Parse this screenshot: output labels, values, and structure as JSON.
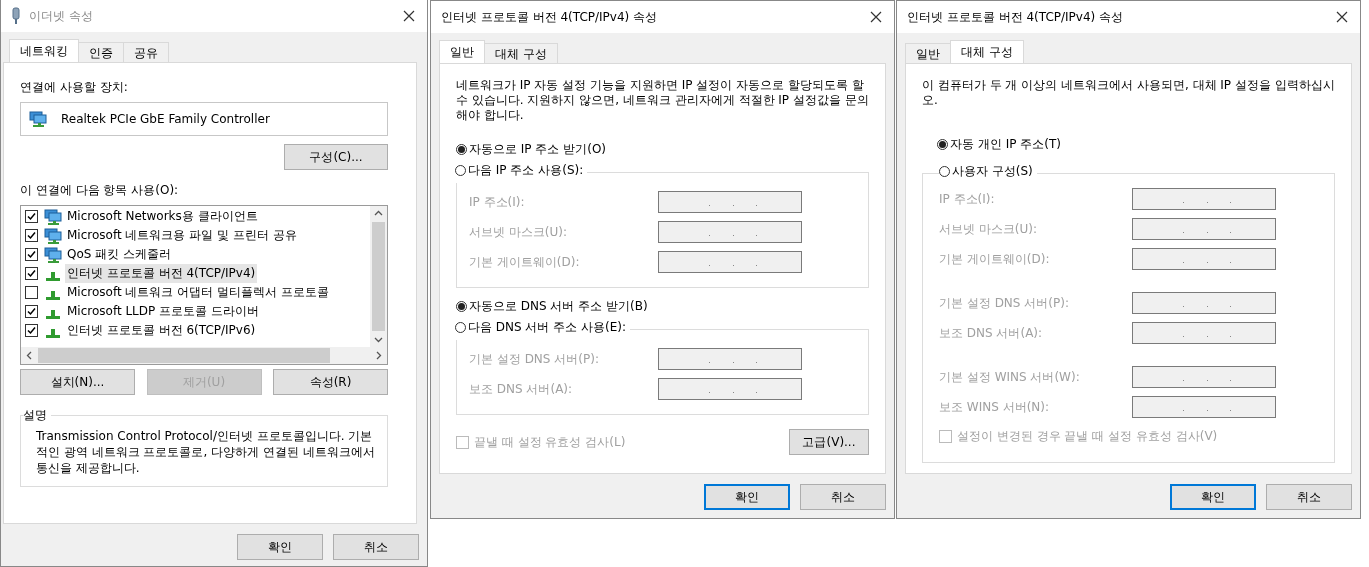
{
  "ethernet_dialog": {
    "title": "이더넷 속성",
    "tabs": [
      {
        "label": "네트워킹",
        "selected": true
      },
      {
        "label": "인증",
        "selected": false
      },
      {
        "label": "공유",
        "selected": false
      }
    ],
    "device_label": "연결에 사용할 장치:",
    "device": "Realtek PCIe GbE Family Controller",
    "configure_button": "구성(C)...",
    "items_label": "이 연결에 다음 항목 사용(O):",
    "items": [
      {
        "kind": "client",
        "label": "Microsoft Networks용 클라이언트",
        "checked": true,
        "selected": false
      },
      {
        "kind": "service",
        "label": "Microsoft 네트워크용 파일 및 프린터 공유",
        "checked": true,
        "selected": false
      },
      {
        "kind": "service",
        "label": "QoS 패킷 스케줄러",
        "checked": true,
        "selected": false
      },
      {
        "kind": "protocol",
        "label": "인터넷 프로토콜 버전 4(TCP/IPv4)",
        "checked": true,
        "selected": true
      },
      {
        "kind": "protocol",
        "label": "Microsoft 네트워크 어댑터 멀티플렉서 프로토콜",
        "checked": false,
        "selected": false
      },
      {
        "kind": "protocol",
        "label": "Microsoft LLDP 프로토콜 드라이버",
        "checked": true,
        "selected": false
      },
      {
        "kind": "protocol",
        "label": "인터넷 프로토콜 버전 6(TCP/IPv6)",
        "checked": true,
        "selected": false
      }
    ],
    "item_buttons": [
      {
        "label": "설치(N)...",
        "disabled": false
      },
      {
        "label": "제거(U)",
        "disabled": true
      },
      {
        "label": "속성(R)",
        "disabled": false
      }
    ],
    "description_title": "설명",
    "description": "Transmission Control Protocol/인터넷 프로토콜입니다. 기본적인 광역 네트워크 프로토콜로, 다양하게 연결된 네트워크에서 통신을 제공합니다.",
    "footer_buttons": [
      {
        "label": "확인",
        "default": false
      },
      {
        "label": "취소",
        "default": false
      }
    ]
  },
  "ipv4_general_dialog": {
    "title": "인터넷 프로토콜 버전 4(TCP/IPv4) 속성",
    "tabs": [
      {
        "label": "일반",
        "selected": true
      },
      {
        "label": "대체 구성",
        "selected": false
      }
    ],
    "intro": "네트워크가 IP 자동 설정 기능을 지원하면 IP 설정이 자동으로 할당되도록 할 수 있습니다. 지원하지 않으면, 네트워크 관리자에게 적절한 IP 설정값을 문의해야 합니다.",
    "sections": [
      {
        "auto_option": {
          "label": "자동으로 IP 주소 받기(O)",
          "selected": true
        },
        "manual_option": {
          "label": "다음 IP 주소 사용(S):",
          "selected": false
        },
        "fields": [
          {
            "label": "IP 주소(I):",
            "disabled": true
          },
          {
            "label": "서브넷 마스크(U):",
            "disabled": true
          },
          {
            "label": "기본 게이트웨이(D):",
            "disabled": true
          }
        ]
      },
      {
        "auto_option": {
          "label": "자동으로 DNS 서버 주소 받기(B)",
          "selected": true
        },
        "manual_option": {
          "label": "다음 DNS 서버 주소 사용(E):",
          "selected": false
        },
        "fields": [
          {
            "label": "기본 설정 DNS 서버(P):",
            "disabled": true
          },
          {
            "label": "보조 DNS 서버(A):",
            "disabled": true
          }
        ]
      }
    ],
    "validate": {
      "label": "끝낼 때 설정 유효성 검사(L)",
      "checked": false,
      "disabled": true
    },
    "advanced_button": "고급(V)...",
    "footer_buttons": [
      {
        "label": "확인",
        "default": true
      },
      {
        "label": "취소",
        "default": false
      }
    ]
  },
  "ipv4_alternate_dialog": {
    "title": "인터넷 프로토콜 버전 4(TCP/IPv4) 속성",
    "tabs": [
      {
        "label": "일반",
        "selected": false
      },
      {
        "label": "대체 구성",
        "selected": true
      }
    ],
    "intro": "이 컴퓨터가 두 개 이상의 네트워크에서 사용되면, 대체 IP 설정을 입력하십시오.",
    "auto_option": {
      "label": "자동 개인 IP 주소(T)",
      "selected": true
    },
    "manual_option": {
      "label": "사용자 구성(S)",
      "selected": false
    },
    "field_groups": [
      [
        {
          "label": "IP 주소(I):",
          "disabled": true
        },
        {
          "label": "서브넷 마스크(U):",
          "disabled": true
        },
        {
          "label": "기본 게이트웨이(D):",
          "disabled": true
        }
      ],
      [
        {
          "label": "기본 설정 DNS 서버(P):",
          "disabled": true
        },
        {
          "label": "보조 DNS 서버(A):",
          "disabled": true
        }
      ],
      [
        {
          "label": "기본 설정 WINS 서버(W):",
          "disabled": true
        },
        {
          "label": "보조 WINS 서버(N):",
          "disabled": true
        }
      ]
    ],
    "validate": {
      "label": "설정이 변경된 경우 끝낼 때 설정 유효성 검사(V)",
      "checked": false,
      "disabled": true
    },
    "footer_buttons": [
      {
        "label": "확인",
        "default": true
      },
      {
        "label": "취소",
        "default": false
      }
    ]
  }
}
